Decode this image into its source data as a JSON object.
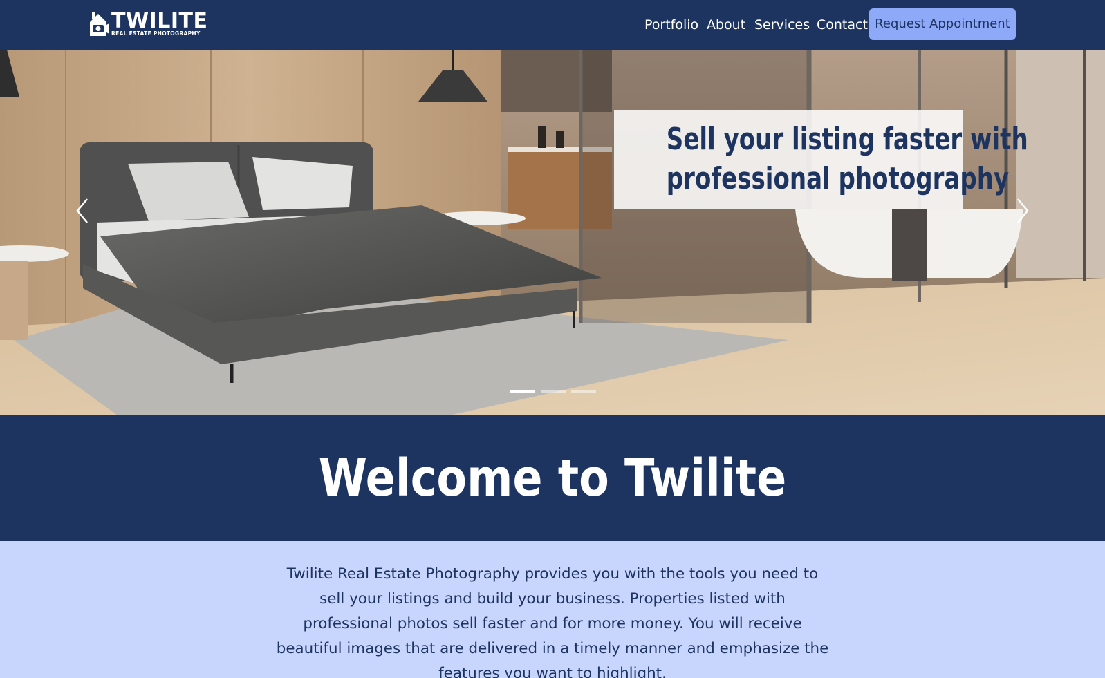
{
  "brand": {
    "name": "TWILITE",
    "tagline": "REAL ESTATE PHOTOGRAPHY",
    "logo_icon": "house-camera-icon"
  },
  "nav": {
    "items": [
      "Portfolio",
      "About",
      "Services",
      "Contact"
    ],
    "cta_label": "Request Appointment"
  },
  "hero": {
    "caption_line1": "Sell your listing faster with",
    "caption_line2": "professional photography",
    "prev_icon": "chevron-left-icon",
    "next_icon": "chevron-right-icon",
    "slide_count": 3,
    "active_slide": 1
  },
  "welcome": {
    "title": "Welcome to Twilite"
  },
  "intro": {
    "text": "Twilite Real Estate Photography provides you with the tools you need to sell your listings and build your business. Properties listed with professional photos sell faster and for more money. You will receive beautiful images that are delivered in a timely manner and emphasize the features you want to highlight."
  },
  "colors": {
    "navy": "#1d3461",
    "cta_bg": "#8fa9f9",
    "intro_bg": "#c8d5fd",
    "white": "#ffffff"
  }
}
